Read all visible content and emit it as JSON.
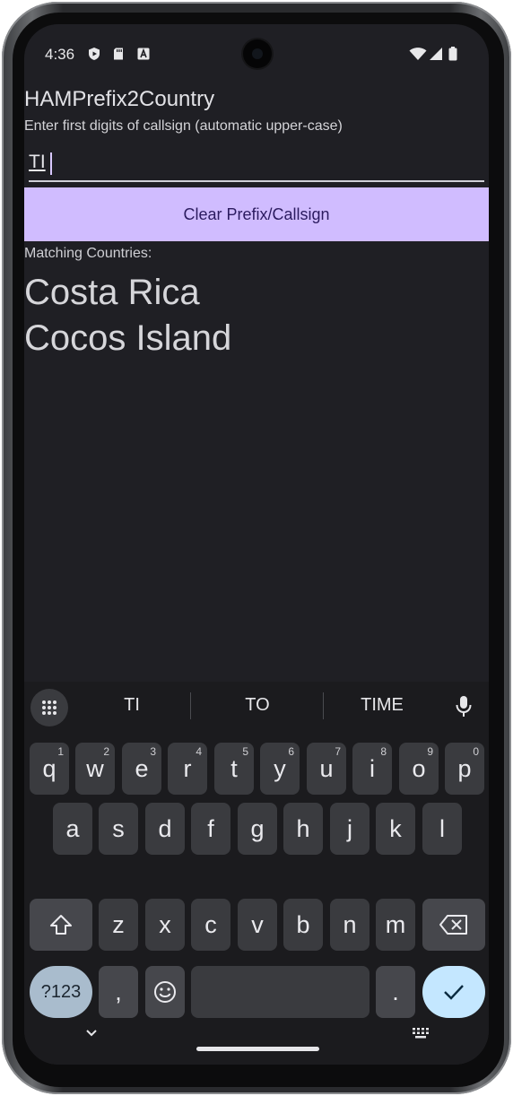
{
  "status_bar": {
    "time": "4:36",
    "left_icons": [
      "shield-play-icon",
      "sd-card-icon",
      "font-icon"
    ],
    "right_icons": [
      "wifi-icon",
      "signal-icon",
      "battery-icon"
    ]
  },
  "app": {
    "title": "HAMPrefix2Country",
    "hint": "Enter first digits of callsign (automatic upper-case)",
    "input_value": "TI",
    "clear_button_label": "Clear Prefix/Callsign",
    "matching_label": "Matching Countries:",
    "countries": [
      "Costa Rica",
      "Cocos Island"
    ]
  },
  "keyboard": {
    "suggestions": [
      "TI",
      "TO",
      "TIME"
    ],
    "row1": [
      {
        "k": "q",
        "n": "1"
      },
      {
        "k": "w",
        "n": "2"
      },
      {
        "k": "e",
        "n": "3"
      },
      {
        "k": "r",
        "n": "4"
      },
      {
        "k": "t",
        "n": "5"
      },
      {
        "k": "y",
        "n": "6"
      },
      {
        "k": "u",
        "n": "7"
      },
      {
        "k": "i",
        "n": "8"
      },
      {
        "k": "o",
        "n": "9"
      },
      {
        "k": "p",
        "n": "0"
      }
    ],
    "row2": [
      "a",
      "s",
      "d",
      "f",
      "g",
      "h",
      "j",
      "k",
      "l"
    ],
    "row3": [
      "z",
      "x",
      "c",
      "v",
      "b",
      "n",
      "m"
    ],
    "symbols_label": "?123",
    "comma_label": ",",
    "period_label": "."
  },
  "colors": {
    "background": "#1f1f24",
    "accent_button": "#d0bcff",
    "enter_key": "#c4e7ff",
    "symbols_key": "#a9bccd"
  }
}
